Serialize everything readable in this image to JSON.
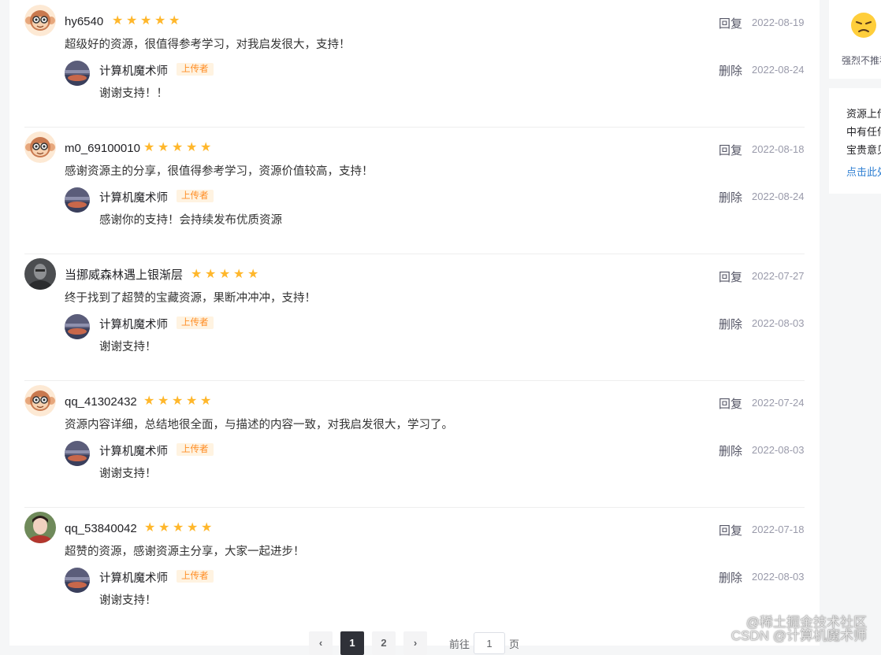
{
  "comments": [
    {
      "user": "hy6540",
      "avatar": "monkey-avatar",
      "text": "超级好的资源，很值得参考学习，对我启发很大，支持！",
      "date": "2022-08-19",
      "reply_label": "回复",
      "rating": 5,
      "reply": {
        "user": "计算机魔术师",
        "badge": "上传者",
        "text": "谢谢支持！！",
        "date": "2022-08-24",
        "delete_label": "删除"
      }
    },
    {
      "user": "m0_69100010",
      "avatar": "monkey-avatar",
      "text": "感谢资源主的分享，很值得参考学习，资源价值较高，支持！",
      "date": "2022-08-18",
      "reply_label": "回复",
      "rating": 5,
      "reply": {
        "user": "计算机魔术师",
        "badge": "上传者",
        "text": "感谢你的支持！会持续发布优质资源",
        "date": "2022-08-24",
        "delete_label": "删除"
      }
    },
    {
      "user": "当挪威森林遇上银渐层",
      "avatar": "dark-avatar",
      "text": "终于找到了超赞的宝藏资源，果断冲冲冲，支持！",
      "date": "2022-07-27",
      "reply_label": "回复",
      "rating": 5,
      "reply": {
        "user": "计算机魔术师",
        "badge": "上传者",
        "text": "谢谢支持！",
        "date": "2022-08-03",
        "delete_label": "删除"
      }
    },
    {
      "user": "qq_41302432",
      "avatar": "monkey-avatar",
      "text": "资源内容详细，总结地很全面，与描述的内容一致，对我启发很大，学习了。",
      "date": "2022-07-24",
      "reply_label": "回复",
      "rating": 5,
      "reply": {
        "user": "计算机魔术师",
        "badge": "上传者",
        "text": "谢谢支持！",
        "date": "2022-08-03",
        "delete_label": "删除"
      }
    },
    {
      "user": "qq_53840042",
      "avatar": "portrait-avatar",
      "text": "超赞的资源，感谢资源主分享，大家一起进步！",
      "date": "2022-07-18",
      "reply_label": "回复",
      "rating": 5,
      "reply": {
        "user": "计算机魔术师",
        "badge": "上传者",
        "text": "谢谢支持！",
        "date": "2022-08-03",
        "delete_label": "删除"
      }
    }
  ],
  "pagination": {
    "prev": "‹",
    "pages": [
      "1",
      "2"
    ],
    "current": "1",
    "next": "›",
    "goto_label": "前往",
    "goto_value": "1",
    "page_suffix": "页"
  },
  "sidebar": {
    "rating_label": "强烈不推荐",
    "notice_lines": [
      "资源上传",
      "中有任何",
      "宝贵意见"
    ],
    "notice_link": "点击此处"
  },
  "watermark": {
    "line1": "@稀土掘金技术社区",
    "line2": "CSDN @计算机魔术师"
  },
  "colors": {
    "star": "#ffb72b",
    "badge_bg": "#fff3e1",
    "badge_text": "#ff8e26",
    "link": "#3281d3"
  }
}
